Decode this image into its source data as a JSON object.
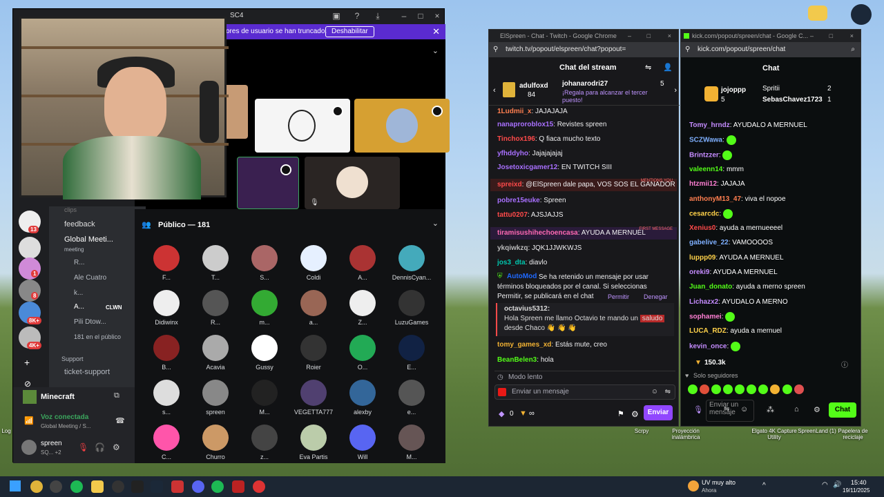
{
  "discord": {
    "title": "SC4",
    "notice": {
      "text": "ores de usuario se han truncado.",
      "button": "Deshabilitar"
    },
    "channels": {
      "clips": "clips",
      "feedback": "feedback",
      "voice_channel": "Global Meeti...",
      "voice_sub": "meeting",
      "voice_users": [
        "R...",
        "Ale Cuatro",
        "k...",
        "A...",
        "Pili Dtow...",
        "181 en el público"
      ],
      "clwn_tag": "CLWN",
      "support_category": "Support",
      "ticket": "ticket-support"
    },
    "activity": "Minecraft",
    "voice_connected": {
      "label": "Voz conectada",
      "sub": "Global Meeting / S..."
    },
    "user": {
      "name": "spreen",
      "status": "SQ... +2"
    },
    "server_badges": [
      "13",
      "1",
      "8",
      "8K+",
      "4K+"
    ],
    "public_header": "Público — 181",
    "members": [
      [
        "F...",
        "T...",
        "S...",
        "Coldi",
        "A...",
        "DennisCyan..."
      ],
      [
        "Didiwinx",
        "R...",
        "m...",
        "a...",
        "Z...",
        "LuzuGames"
      ],
      [
        "B...",
        "Acavia",
        "Gussy",
        "Roier",
        "O...",
        "E..."
      ],
      [
        "s...",
        "spreen",
        "M...",
        "VEGETTA777",
        "alexby",
        "e..."
      ],
      [
        "C...",
        "Churro",
        "z...",
        "Eva Partis",
        "Will",
        "M..."
      ]
    ]
  },
  "twitch": {
    "window_title": "ElSpreen - Chat - Twitch - Google Chrome",
    "url": "twitch.tv/popout/elspreen/chat?popout=",
    "header": "Chat del stream",
    "top_user1": {
      "name": "adulfoxd",
      "count": "84"
    },
    "top_user2": {
      "name": "johanarodri27",
      "count": "5",
      "text": "¡Regala para alcanzar el tercer puesto!"
    },
    "messages": [
      {
        "user": "1Ludmii_x",
        "text": "JAJAJAJA",
        "color": "#ff7f50"
      },
      {
        "user": "nanaproroblox15",
        "text": "Revistes spreen",
        "color": "#a970ff"
      },
      {
        "user": "Tinchox196",
        "text": "Q fiaca mucho texto",
        "color": "#ff4a4a"
      },
      {
        "user": "yfhddyho",
        "text": "Jajajajajaj",
        "color": "#a970ff"
      },
      {
        "user": "Josetoxicgamer12",
        "text": "EN TWITCH SIII",
        "color": "#a970ff"
      },
      {
        "user": "spreixd",
        "text": "@ElSpreen dale papa, VOS SOS EL GANADOR",
        "color": "#ff4a4a",
        "tag": "MENTIONS YOU"
      },
      {
        "user": "pobre15euke",
        "text": "Spreen",
        "color": "#a970ff"
      },
      {
        "user": "tattu0207",
        "text": "AJSJAJJS",
        "color": "#ff4a4a"
      },
      {
        "user": "tiramisushihechoencasa",
        "text": "AYUDA A MERNUEL",
        "color": "#ff69b4",
        "tag": "FIRST MESSAGE"
      },
      {
        "user": "ykqiwkzq",
        "text": "JQK1JJWKWJS",
        "color": "#bbbbbb"
      },
      {
        "user": "jos3_dta",
        "text": "diavlo",
        "color": "#00c8af"
      }
    ],
    "automod": {
      "user": "AutoMod",
      "text": "Se ha retenido un mensaje por usar términos bloqueados por el canal. Si seleccionas Permitir, se publicará en el chat",
      "allow": "Permitir",
      "deny": "Denegar",
      "held_user": "octavius5312:",
      "held_text_a": "Hola Spreen me llamo Octavio te mando un",
      "held_word": "saludo",
      "held_text_b": "desde Chaco 👋 👋 👋"
    },
    "after": [
      {
        "user": "tomy_games_xd",
        "text": "Estás mute, creo",
        "color": "#f2b233"
      },
      {
        "user": "BeanBelen3",
        "text": "hola",
        "color": "#53fc18"
      }
    ],
    "slow_mode": "Modo lento",
    "input_placeholder": "Enviar un mensaje",
    "points": "0",
    "infinity": "∞",
    "send": "Enviar"
  },
  "kick": {
    "window_title": "kick.com/popout/spreen/chat - Google C...",
    "url": "kick.com/popout/spreen/chat",
    "header": "Chat",
    "leader1": {
      "name": "jojoppp",
      "count": "5"
    },
    "leader2": {
      "name": "Spritii",
      "count": "2"
    },
    "leader3": {
      "name": "SebasChavez1723",
      "count": "1"
    },
    "messages": [
      {
        "user": "Tomy_hrndz",
        "text": "AYUDALO A MERNUEL",
        "color": "#c58cff"
      },
      {
        "user": "SCZWawa",
        "text": "",
        "color": "#7fb0ff"
      },
      {
        "user": "Brintzzer",
        "text": "",
        "color": "#c58cff"
      },
      {
        "user": "valeenn14",
        "text": "mmm",
        "color": "#53fc18"
      },
      {
        "user": "htzmii12",
        "text": "JAJAJA",
        "color": "#ff7fd4"
      },
      {
        "user": "anthonyM13_47",
        "text": "viva el nopoe",
        "color": "#ff7f50"
      },
      {
        "user": "cesarcdc",
        "text": "",
        "color": "#ffd24a"
      },
      {
        "user": "Xenius0",
        "text": "ayuda a mernueeeel",
        "color": "#ff4a4a"
      },
      {
        "user": "gabelive_22",
        "text": "VAMOOOOS",
        "color": "#7fb0ff"
      },
      {
        "user": "luppp09",
        "text": "AYUDA A MERNUEL",
        "color": "#ffd24a"
      },
      {
        "user": "oreki9",
        "text": "AYUDA A MERNUEL",
        "color": "#c58cff"
      },
      {
        "user": "Juan_donato",
        "text": "ayuda a merno spreen",
        "color": "#53fc18"
      },
      {
        "user": "Lichazx2",
        "text": "AYUDALO A MERNO",
        "color": "#c58cff"
      },
      {
        "user": "sophamei",
        "text": "",
        "color": "#ff7fd4"
      },
      {
        "user": "LUCA_RDZ",
        "text": "ayuda a mernuel",
        "color": "#ffd24a"
      },
      {
        "user": "kevin_once",
        "text": "",
        "color": "#c58cff"
      }
    ],
    "viewers": "150.3k",
    "followers_only": "Solo seguidores",
    "input_placeholder": "Enviar un mensaje",
    "send": "Chat"
  },
  "desktop": {
    "labels": [
      "Scrpy",
      "Proyección inalámbrica",
      "Elgato 4K Capture Utility",
      "SpreenLand (1)",
      "Papelera de reciclaje",
      "Log"
    ]
  },
  "taskbar": {
    "weather": "UV muy alto",
    "weather_sub": "Ahora",
    "time": "15:40",
    "date": "19/11/2025"
  },
  "colors": {
    "twitch": "#9147ff",
    "kick": "#53fc18",
    "discord_notice": "#5a2bd0"
  }
}
